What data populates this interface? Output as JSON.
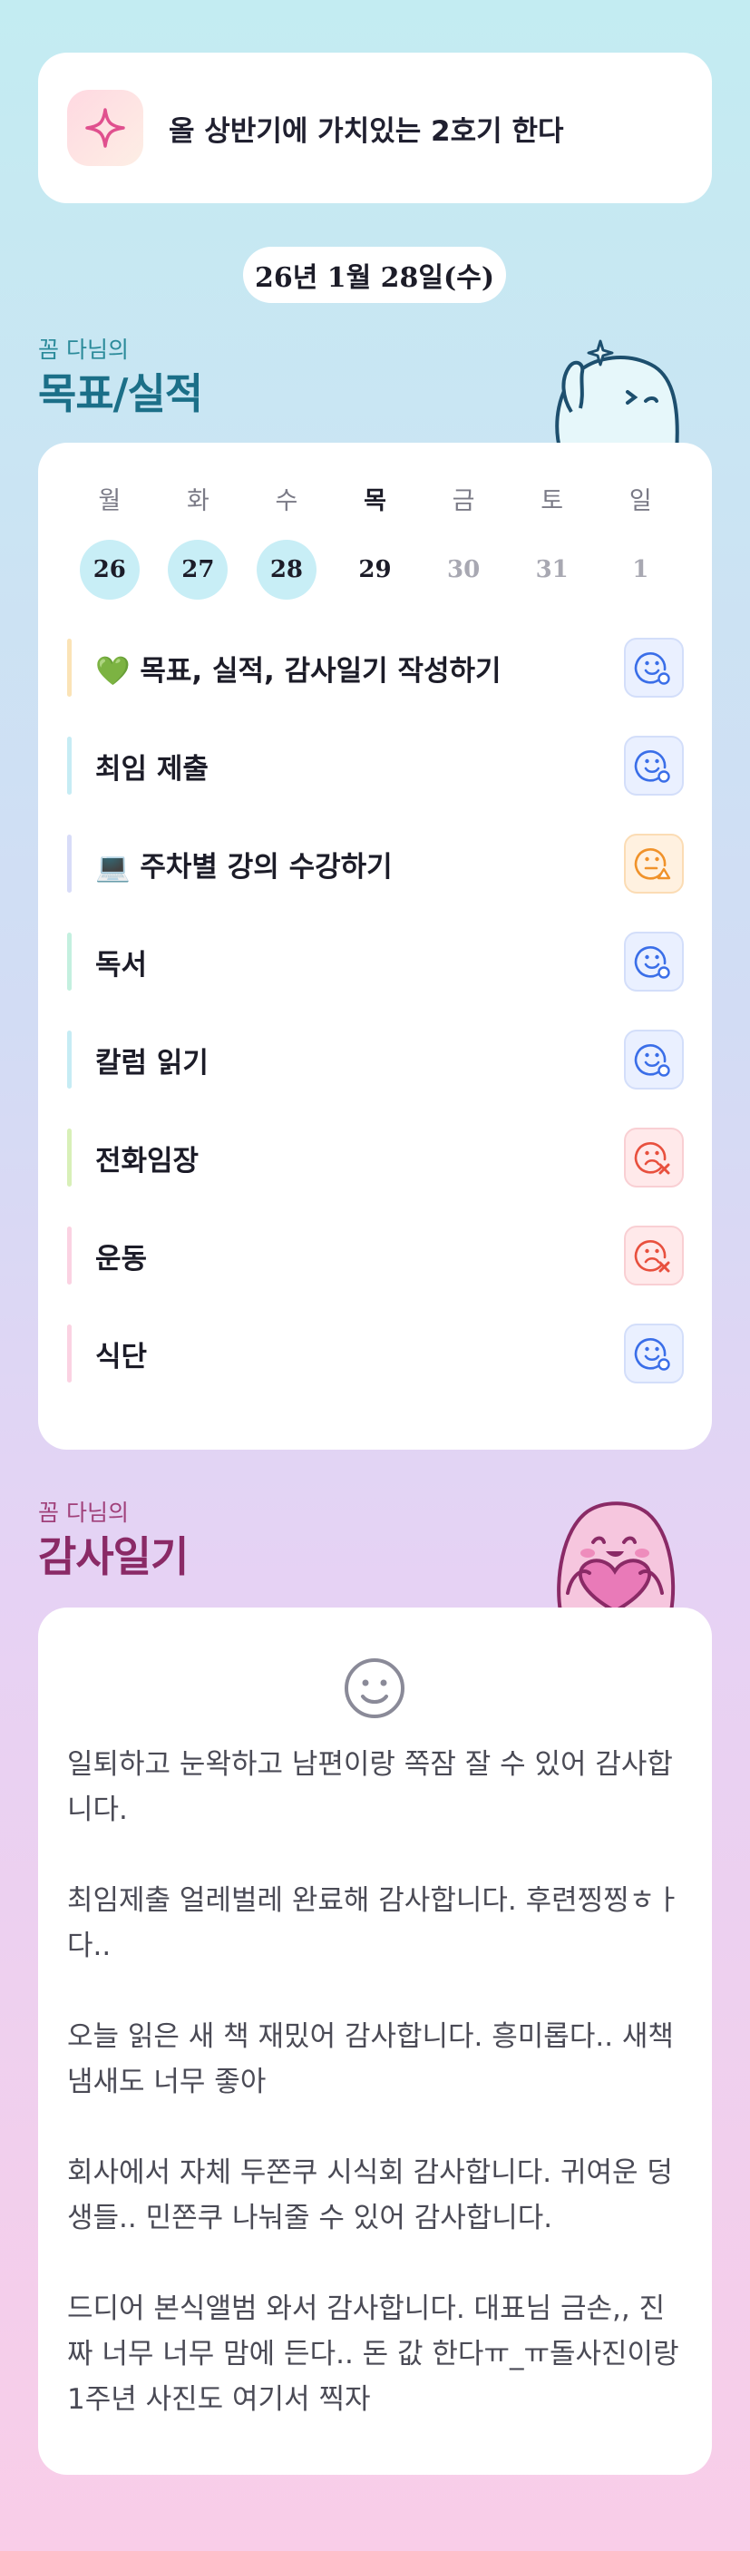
{
  "goal_banner": {
    "icon": "sparkle-icon",
    "text": "올 상반기에 가치있는 2호기 한다"
  },
  "date_label": "26년 1월 28일(수)",
  "goals_section": {
    "subtitle": "꼼 다님의",
    "title": "목표/실적"
  },
  "week": {
    "days": [
      {
        "name": "월",
        "date": "26",
        "state": "done"
      },
      {
        "name": "화",
        "date": "27",
        "state": "done"
      },
      {
        "name": "수",
        "date": "28",
        "state": "done"
      },
      {
        "name": "목",
        "date": "29",
        "state": "today"
      },
      {
        "name": "금",
        "date": "30",
        "state": "future"
      },
      {
        "name": "토",
        "date": "31",
        "state": "future"
      },
      {
        "name": "일",
        "date": "1",
        "state": "future"
      }
    ]
  },
  "goals": [
    {
      "label": "💚 목표, 실적, 감사일기 작성하기",
      "status": "good",
      "bar_color": "#fbe3b6"
    },
    {
      "label": "최임 제출",
      "status": "good",
      "bar_color": "#c6ecf4"
    },
    {
      "label": "💻 주차별 강의 수강하기",
      "status": "meh",
      "bar_color": "#d8dcf8"
    },
    {
      "label": "독서",
      "status": "good",
      "bar_color": "#c4f0df"
    },
    {
      "label": "칼럼 읽기",
      "status": "good",
      "bar_color": "#c6ecf4"
    },
    {
      "label": "전화임장",
      "status": "bad",
      "bar_color": "#d8f0b8"
    },
    {
      "label": "운동",
      "status": "bad",
      "bar_color": "#fbd2e2"
    },
    {
      "label": "식단",
      "status": "good",
      "bar_color": "#fbd2e2"
    }
  ],
  "gratitude_section": {
    "subtitle": "꼼 다님의",
    "title": "감사일기",
    "mood_icon": "smile-face-icon",
    "entries": [
      "일퇴하고 눈왁하고 남편이랑 쪽잠 잘 수 있어 감사합니다.",
      "최임제출 얼레벌레 완료해 감사합니다. 후련찡찡ㅎㅏ다..",
      "오늘 읽은 새 책 재밌어 감사합니다. 흥미롭다.. 새책 냄새도 너무 좋아",
      "회사에서 자체 두쫀쿠 시식회 감사합니다. 귀여운 덩생들.. 민쫀쿠 나눠줄 수 있어 감사합니다.",
      "드디어 본식앨범 와서 감사합니다. 대표님 금손,, 진짜 너무 너무 맘에 든다.. 돈 값 한다ㅠ_ㅠ돌사진이랑 1주년 사진도 여기서 찍자"
    ]
  },
  "colors": {
    "good": "#3a6ee8",
    "meh": "#f0922a",
    "bad": "#e8503e"
  }
}
